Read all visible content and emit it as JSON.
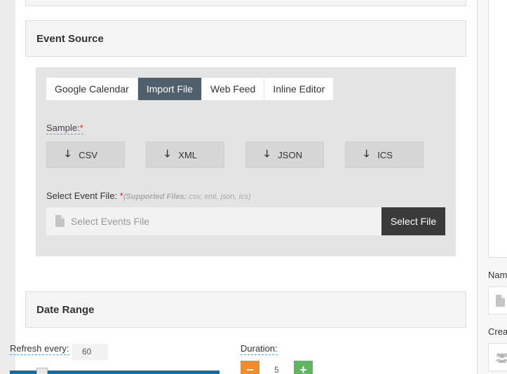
{
  "event_source": {
    "title": "Event Source",
    "tabs": [
      {
        "label": "Google Calendar"
      },
      {
        "label": "Import File"
      },
      {
        "label": "Web Feed"
      },
      {
        "label": "Inline Editor"
      }
    ],
    "active_tab": "Import File",
    "sample_label": "Sample:",
    "required_mark": "*",
    "samples": [
      {
        "label": "CSV",
        "icon": "download-arrow-icon"
      },
      {
        "label": "XML",
        "icon": "download-arrow-icon"
      },
      {
        "label": "JSON",
        "icon": "download-arrow-icon"
      },
      {
        "label": "ICS",
        "icon": "download-arrow-icon"
      }
    ],
    "arrow_glyph": "🡓",
    "select_file_label": "Select Event File:",
    "supported_prefix": "(Supported Files:",
    "supported_list": "csv, xml, json, ics)",
    "file_placeholder": "Select Events File",
    "select_file_button": "Select File"
  },
  "date_range": {
    "title": "Date Range",
    "refresh_label": "Refresh every:",
    "refresh_value": "60",
    "duration_label": "Duration:",
    "duration_value": "5",
    "minus_glyph": "−",
    "plus_glyph": "+"
  },
  "right_panel": {
    "name_label": "Nam",
    "created_label": "Crea"
  },
  "colors": {
    "active_tab": "#4f5f6b",
    "dark_button": "#3a3a3a",
    "slider": "#0f6fa8",
    "minus": "#f28c2a",
    "plus": "#5cb85c",
    "required": "#d9231c"
  }
}
